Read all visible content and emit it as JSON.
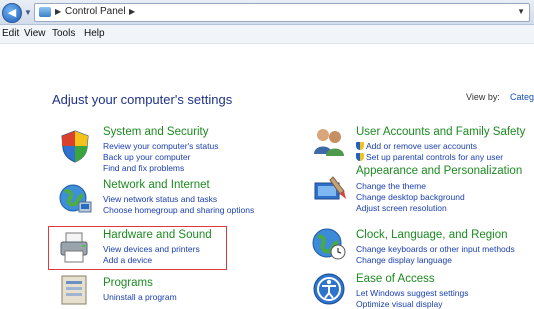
{
  "address_bar": {
    "breadcrumb": "Control Panel",
    "back_icon": "back-arrow-icon",
    "dropdown_icon": "chevron-down-icon"
  },
  "menu": [
    "Edit",
    "View",
    "Tools",
    "Help"
  ],
  "main": {
    "title": "Adjust your computer's settings",
    "view_by_label": "View by:",
    "view_by_value": "Catego"
  },
  "categories": {
    "system_security": {
      "title": "System and Security",
      "icon": "security-shield-icon",
      "links": [
        "Review your computer's status",
        "Back up your computer",
        "Find and fix problems"
      ]
    },
    "network_internet": {
      "title": "Network and Internet",
      "icon": "network-globe-icon",
      "links": [
        "View network status and tasks",
        "Choose homegroup and sharing options"
      ]
    },
    "hardware_sound": {
      "title": "Hardware and Sound",
      "icon": "printer-icon",
      "links": [
        "View devices and printers",
        "Add a device"
      ]
    },
    "programs": {
      "title": "Programs",
      "icon": "programs-icon",
      "links": [
        "Uninstall a program"
      ]
    },
    "user_accounts": {
      "title": "User Accounts and Family Safety",
      "icon": "users-icon",
      "links": [
        "Add or remove user accounts",
        "Set up parental controls for any user"
      ]
    },
    "appearance": {
      "title": "Appearance and Personalization",
      "icon": "paint-brush-icon",
      "links": [
        "Change the theme",
        "Change desktop background",
        "Adjust screen resolution"
      ]
    },
    "clock_language": {
      "title": "Clock, Language, and Region",
      "icon": "clock-globe-icon",
      "links": [
        "Change keyboards or other input methods",
        "Change display language"
      ]
    },
    "ease_access": {
      "title": "Ease of Access",
      "icon": "ease-of-access-icon",
      "links": [
        "Let Windows suggest settings",
        "Optimize visual display"
      ]
    }
  },
  "colors": {
    "title_green": "#1c8a21",
    "link_blue": "#1a3fb0",
    "heading_blue": "#1e3287",
    "highlight_red": "#e0393d"
  }
}
